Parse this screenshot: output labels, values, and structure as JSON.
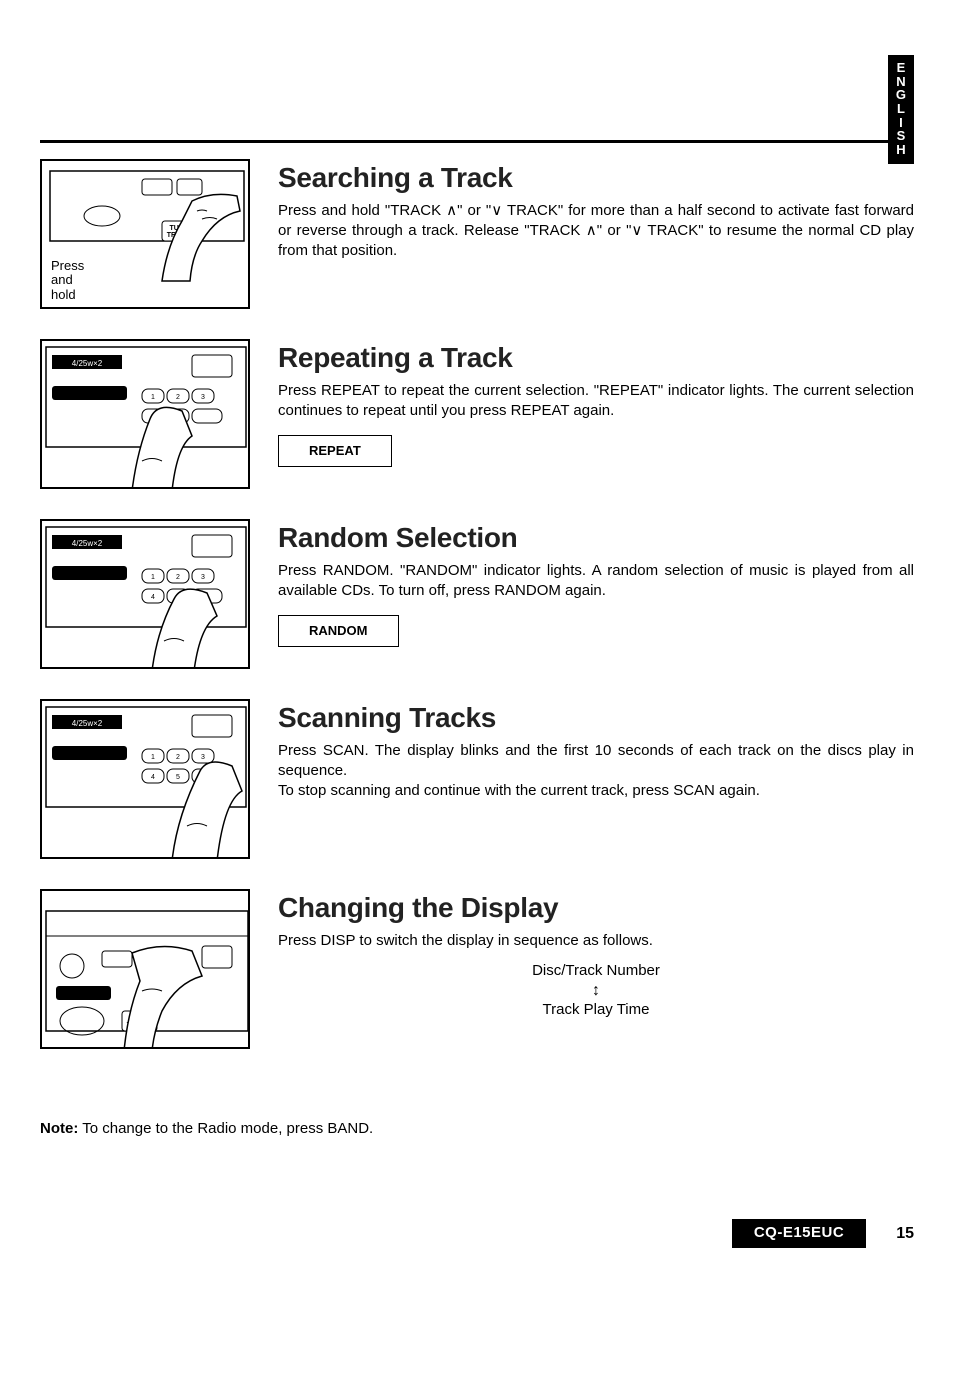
{
  "language_tab": [
    "E",
    "N",
    "G",
    "L",
    "I",
    "S",
    "H"
  ],
  "sections": [
    {
      "heading": "Searching a Track",
      "body": "Press and hold \"TRACK ∧\" or \"∨ TRACK\" for more than a half second to activate fast forward or reverse through a track. Release \"TRACK ∧\" or \"∨ TRACK\" to resume the normal CD play from that position.",
      "illus_caption": "Press\nand\nhold"
    },
    {
      "heading": "Repeating a Track",
      "body": "Press REPEAT to repeat the current selection. \"REPEAT\" indicator lights. The current selection continues to repeat until you press REPEAT again.",
      "button": "REPEAT"
    },
    {
      "heading": "Random Selection",
      "body": "Press RANDOM. \"RANDOM\" indicator lights. A random selection of music is played from all available CDs. To turn off, press RANDOM again.",
      "button": "RANDOM"
    },
    {
      "heading": "Scanning Tracks",
      "body": "Press SCAN. The display blinks and the first 10 seconds of each track on the discs play in sequence.\nTo stop scanning and continue with the current track, press SCAN again."
    },
    {
      "heading": "Changing the Display",
      "body": "Press DISP to switch the display in sequence as follows.",
      "display_top": "Disc/Track Number",
      "display_bottom": "Track Play Time"
    }
  ],
  "note_label": "Note:",
  "note_text": "To change to the Radio mode, press BAND.",
  "model": "CQ-E15EUC",
  "page_number": "15"
}
